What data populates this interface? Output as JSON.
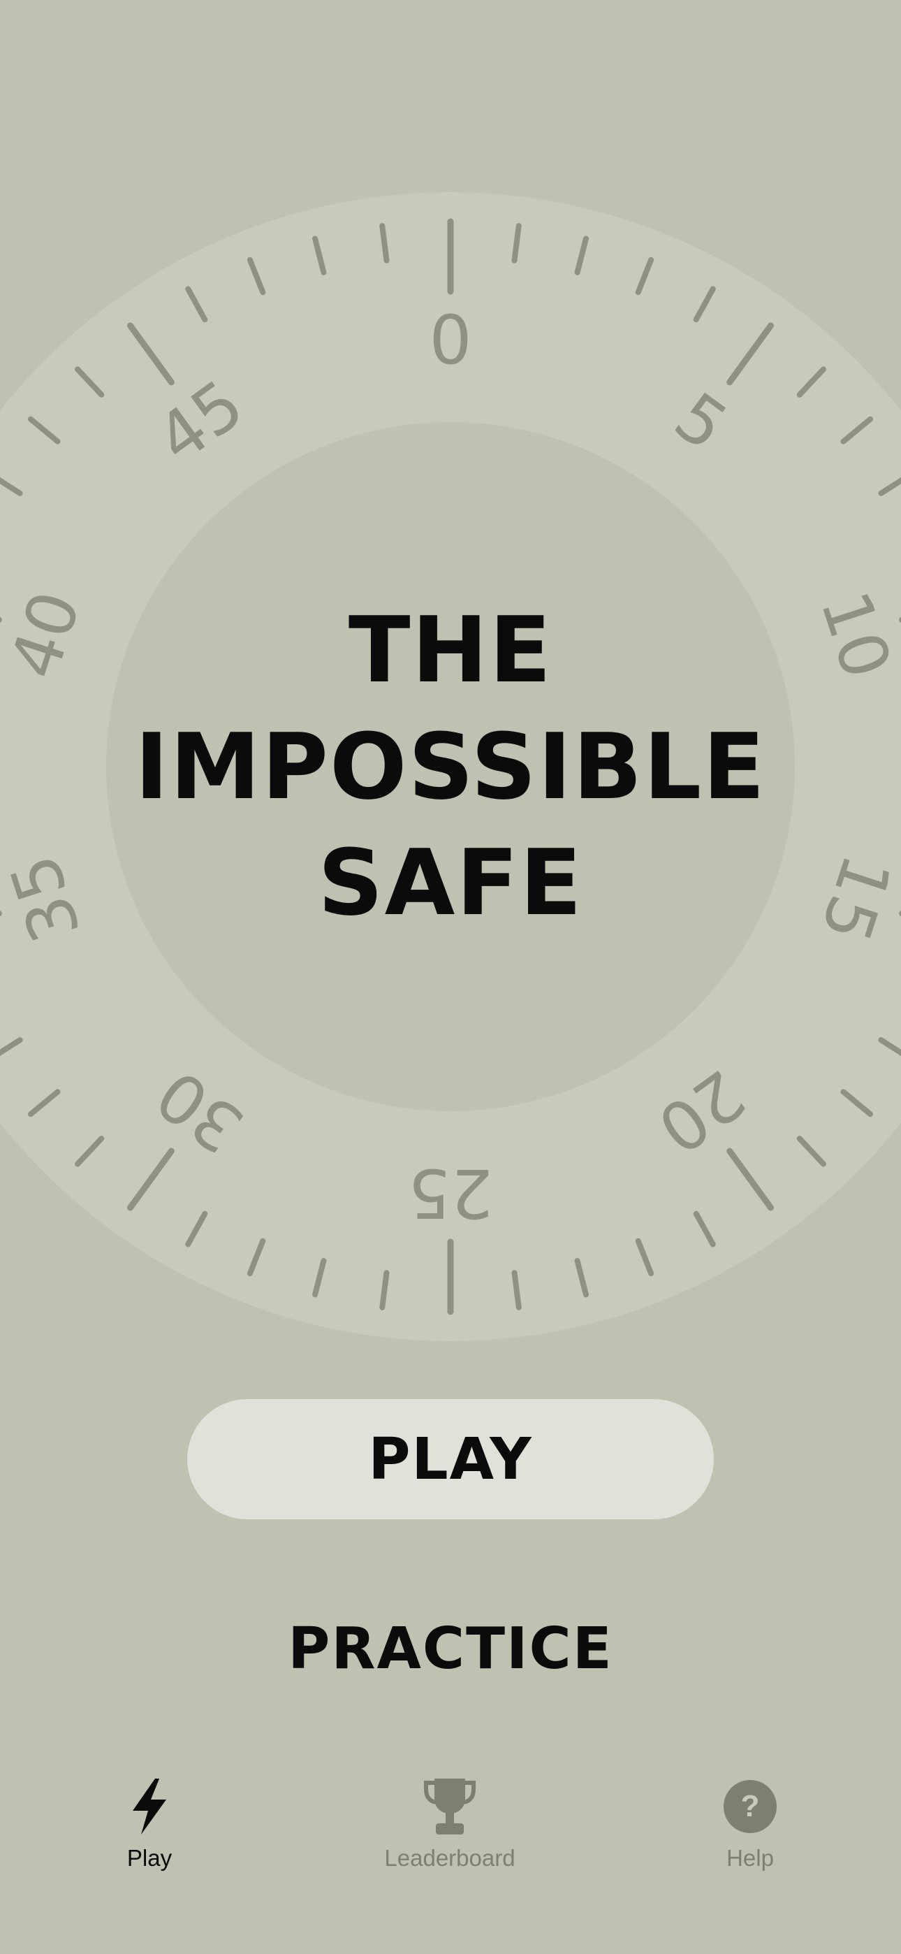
{
  "colors": {
    "background": "#bfc2b1",
    "dial_ring": "#c9cbba",
    "dial_center": "#bfc2b1",
    "dial_marks": "#8f9282",
    "text": "#0b0b0b",
    "tab_inactive": "#7d806f",
    "button_bg": "#e0e1d9"
  },
  "dial": {
    "numbers": [
      "0",
      "5",
      "10",
      "15",
      "20",
      "25",
      "30",
      "35",
      "40",
      "45"
    ]
  },
  "title_lines": [
    "THE",
    "IMPOSSIBLE",
    "SAFE"
  ],
  "buttons": {
    "play": "PLAY",
    "practice": "PRACTICE"
  },
  "tabs": [
    {
      "label": "Play",
      "icon": "lightning-icon",
      "active": true
    },
    {
      "label": "Leaderboard",
      "icon": "trophy-icon",
      "active": false
    },
    {
      "label": "Help",
      "icon": "question-icon",
      "active": false
    }
  ]
}
